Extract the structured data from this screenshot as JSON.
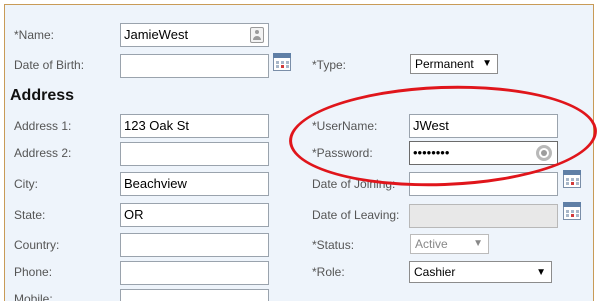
{
  "labels": {
    "name": "*Name:",
    "dob": "Date of Birth:",
    "type": "*Type:",
    "address1": "Address 1:",
    "address2": "Address 2:",
    "city": "City:",
    "state": "State:",
    "country": "Country:",
    "phone": "Phone:",
    "mobile": "Mobile:",
    "username": "*UserName:",
    "password": "*Password:",
    "date_joining": "Date of Joining:",
    "date_leaving": "Date of Leaving:",
    "status": "*Status:",
    "role": "*Role:"
  },
  "section_address": "Address",
  "values": {
    "name": "JamieWest",
    "dob": "",
    "address1": "123 Oak St",
    "address2": "",
    "city": "Beachview",
    "state": "OR",
    "country": "",
    "phone": "",
    "mobile": "",
    "username": "JWest",
    "password": "••••••••",
    "date_joining": "",
    "date_leaving": ""
  },
  "selects": {
    "type": "Permanent",
    "status": "Active",
    "role": "Cashier"
  },
  "icons": {
    "name_card": "contact-card-icon",
    "calendar": "calendar-icon",
    "password_reveal": "password-reveal-icon",
    "dropdown": "dropdown-arrow-icon"
  },
  "colors": {
    "panel_bg": "#eef4fb",
    "panel_border": "#c89b57",
    "annotation": "#e0151b"
  }
}
